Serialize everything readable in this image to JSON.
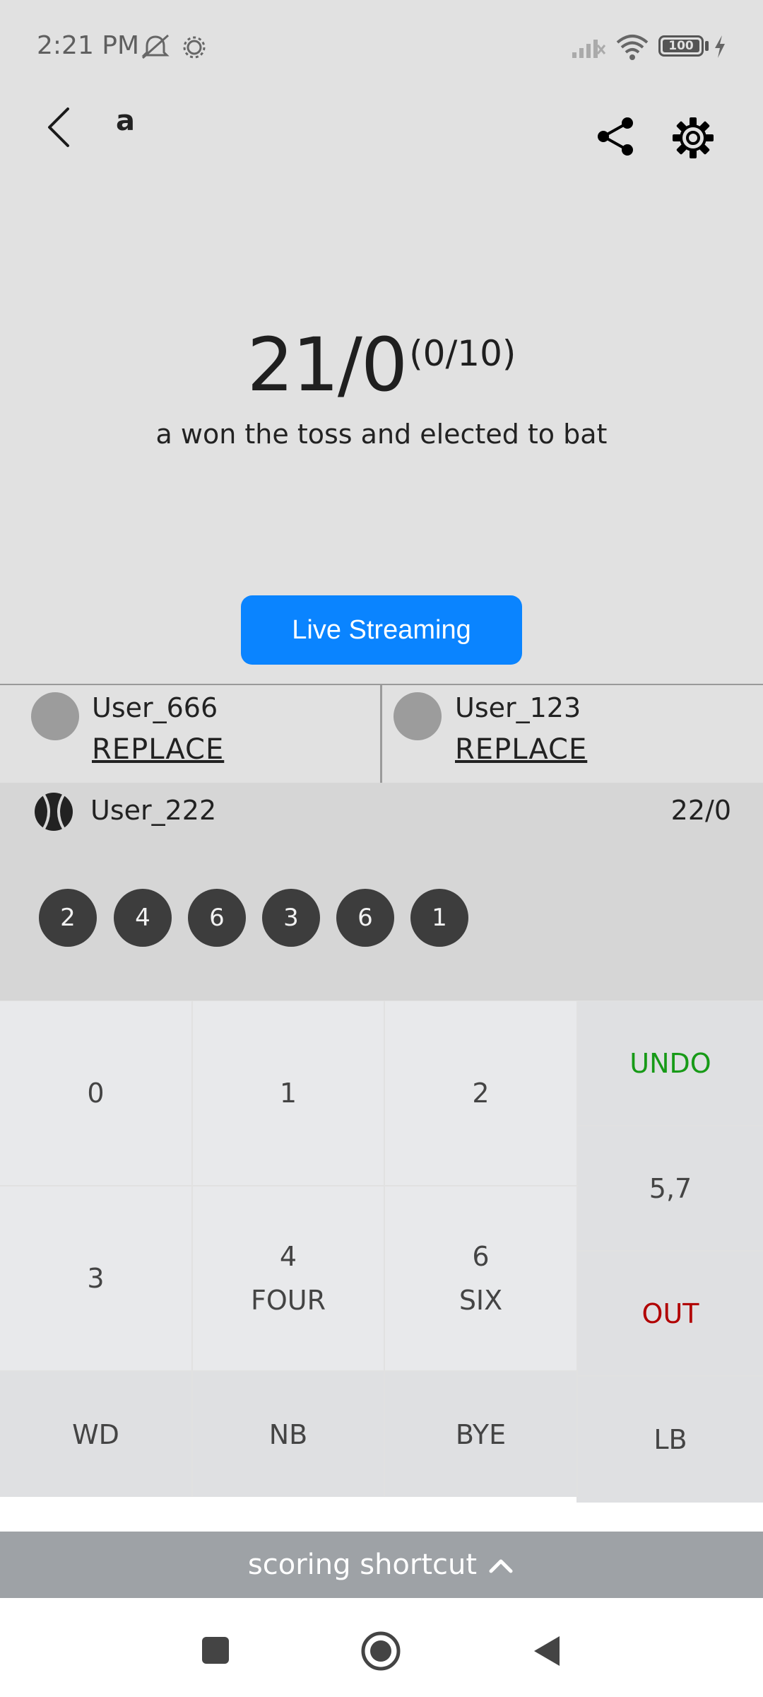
{
  "status_bar": {
    "time": "2:21 PM",
    "battery": "100",
    "icons": [
      "bell-off-icon",
      "settings-sun-icon",
      "signal-icon",
      "wifi-icon",
      "battery-icon",
      "charging-icon"
    ]
  },
  "header": {
    "title": "a"
  },
  "score": {
    "main": "21/0",
    "overs": "(0/10)",
    "toss": "a won the toss and elected to bat"
  },
  "live_button": "Live Streaming",
  "batsmen": [
    {
      "name": "User_666",
      "action": "REPLACE"
    },
    {
      "name": "User_123",
      "action": "REPLACE"
    }
  ],
  "bowler": {
    "name": "User_222",
    "figures": "22/0"
  },
  "balls": [
    "2",
    "4",
    "6",
    "3",
    "6",
    "1"
  ],
  "keypad": {
    "k0": "0",
    "k1": "1",
    "k2": "2",
    "k3": "3",
    "k4": "4",
    "k4_label": "FOUR",
    "k6": "6",
    "k6_label": "SIX",
    "wd": "WD",
    "nb": "NB",
    "bye": "BYE",
    "undo": "UNDO",
    "k57": "5,7",
    "out": "OUT",
    "lb": "LB"
  },
  "shortcut": "scoring shortcut",
  "colors": {
    "accent": "#0a84ff",
    "undo": "#179a17",
    "out": "#b10000"
  }
}
